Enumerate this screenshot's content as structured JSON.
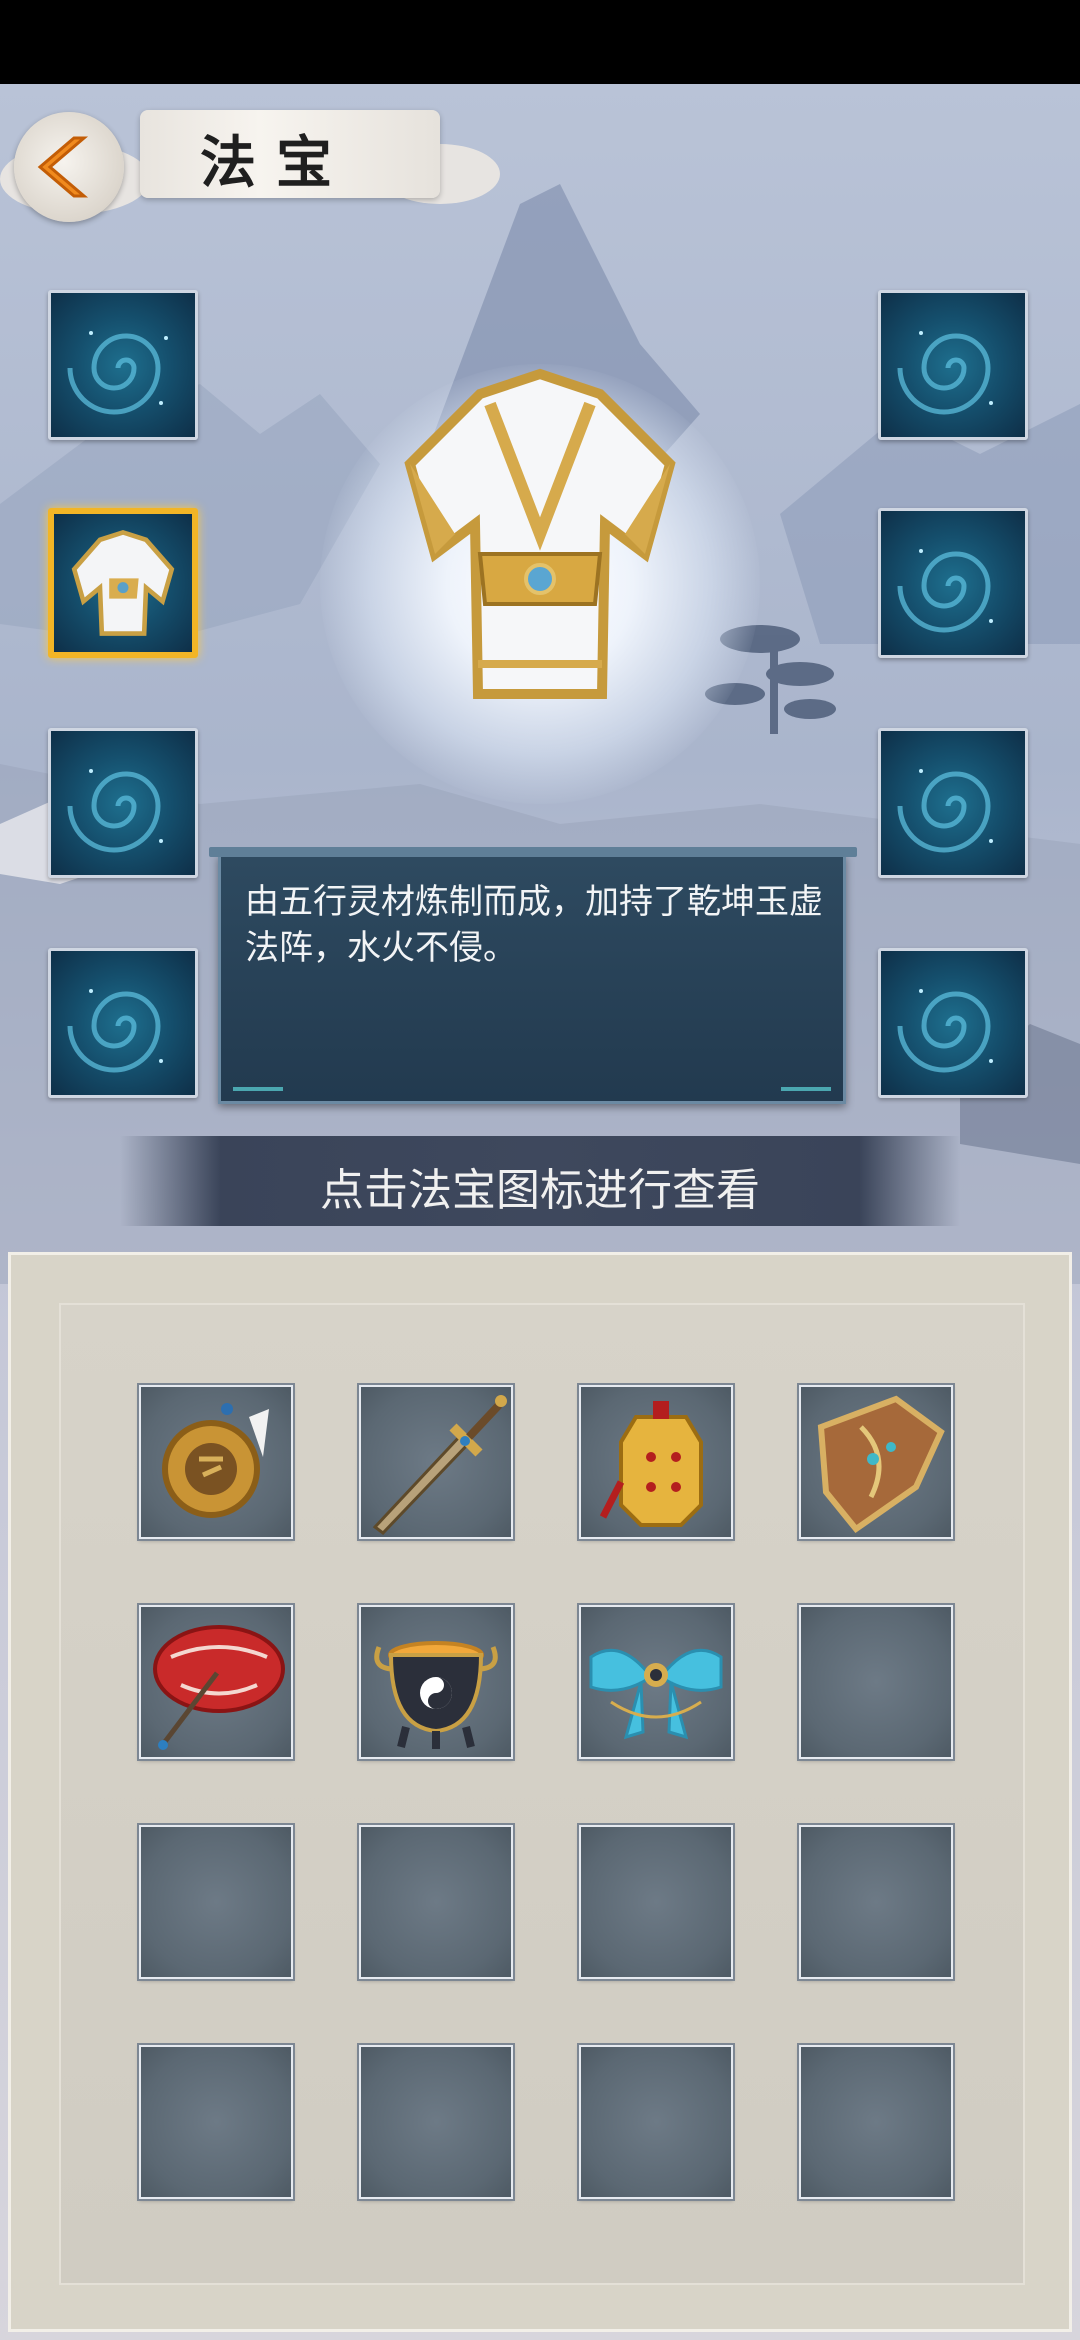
{
  "header": {
    "title": "法宝",
    "back_icon": "back-arrow-icon"
  },
  "equip_slots": {
    "left": [
      {
        "state": "empty",
        "icon": "swirl-portal-icon"
      },
      {
        "state": "equipped",
        "icon": "white-gold-robe-icon",
        "selected": true
      },
      {
        "state": "empty",
        "icon": "swirl-portal-icon"
      },
      {
        "state": "empty",
        "icon": "swirl-portal-icon"
      }
    ],
    "right": [
      {
        "state": "empty",
        "icon": "swirl-portal-icon"
      },
      {
        "state": "empty",
        "icon": "swirl-portal-icon"
      },
      {
        "state": "empty",
        "icon": "swirl-portal-icon"
      },
      {
        "state": "empty",
        "icon": "swirl-portal-icon"
      }
    ]
  },
  "selected_item": {
    "icon": "white-gold-robe-icon",
    "description": "由五行灵材炼制而成，加持了乾坤玉虚法阵，水火不侵。"
  },
  "hint": "点击法宝图标进行查看",
  "inventory": {
    "rows": 4,
    "cols": 4,
    "items": [
      {
        "icon": "golden-seal-pendant-icon"
      },
      {
        "icon": "sword-icon"
      },
      {
        "icon": "golden-bell-icon"
      },
      {
        "icon": "bronze-shield-icon"
      },
      {
        "icon": "red-umbrella-icon"
      },
      {
        "icon": "yin-yang-cauldron-icon"
      },
      {
        "icon": "blue-silk-sash-icon"
      },
      {
        "icon": "empty-slot"
      },
      {
        "icon": "empty-slot"
      },
      {
        "icon": "empty-slot"
      },
      {
        "icon": "empty-slot"
      },
      {
        "icon": "empty-slot"
      },
      {
        "icon": "empty-slot"
      },
      {
        "icon": "empty-slot"
      },
      {
        "icon": "empty-slot"
      },
      {
        "icon": "empty-slot"
      }
    ]
  },
  "colors": {
    "selected_border": "#f2b526",
    "panel_bg": "#2a4458",
    "inventory_bg": "#d8d4c8",
    "cell_bg": "#5f6b76"
  }
}
